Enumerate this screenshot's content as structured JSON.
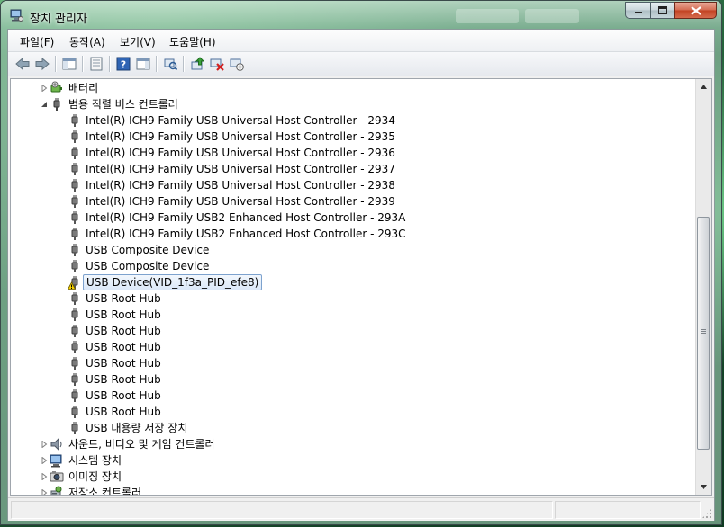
{
  "window": {
    "title": "장치 관리자"
  },
  "menubar": {
    "items": [
      "파일(F)",
      "동작(A)",
      "보기(V)",
      "도움말(H)"
    ]
  },
  "tree": {
    "rows": [
      {
        "label": "배터리",
        "level": 1,
        "expander": "collapsed",
        "icon": "battery-icon"
      },
      {
        "label": "범용 직렬 버스 컨트롤러",
        "level": 1,
        "expander": "expanded",
        "icon": "usb-controller-icon"
      },
      {
        "label": "Intel(R) ICH9 Family USB Universal Host Controller - 2934",
        "level": 2,
        "icon": "usb-plug-icon"
      },
      {
        "label": "Intel(R) ICH9 Family USB Universal Host Controller - 2935",
        "level": 2,
        "icon": "usb-plug-icon"
      },
      {
        "label": "Intel(R) ICH9 Family USB Universal Host Controller - 2936",
        "level": 2,
        "icon": "usb-plug-icon"
      },
      {
        "label": "Intel(R) ICH9 Family USB Universal Host Controller - 2937",
        "level": 2,
        "icon": "usb-plug-icon"
      },
      {
        "label": "Intel(R) ICH9 Family USB Universal Host Controller - 2938",
        "level": 2,
        "icon": "usb-plug-icon"
      },
      {
        "label": "Intel(R) ICH9 Family USB Universal Host Controller - 2939",
        "level": 2,
        "icon": "usb-plug-icon"
      },
      {
        "label": "Intel(R) ICH9 Family USB2 Enhanced Host Controller - 293A",
        "level": 2,
        "icon": "usb-plug-icon"
      },
      {
        "label": "Intel(R) ICH9 Family USB2 Enhanced Host Controller - 293C",
        "level": 2,
        "icon": "usb-plug-icon"
      },
      {
        "label": "USB Composite Device",
        "level": 2,
        "icon": "usb-plug-icon"
      },
      {
        "label": "USB Composite Device",
        "level": 2,
        "icon": "usb-plug-icon"
      },
      {
        "label": "USB Device(VID_1f3a_PID_efe8)",
        "level": 2,
        "icon": "usb-warning-icon",
        "selected": true
      },
      {
        "label": "USB Root Hub",
        "level": 2,
        "icon": "usb-plug-icon"
      },
      {
        "label": "USB Root Hub",
        "level": 2,
        "icon": "usb-plug-icon"
      },
      {
        "label": "USB Root Hub",
        "level": 2,
        "icon": "usb-plug-icon"
      },
      {
        "label": "USB Root Hub",
        "level": 2,
        "icon": "usb-plug-icon"
      },
      {
        "label": "USB Root Hub",
        "level": 2,
        "icon": "usb-plug-icon"
      },
      {
        "label": "USB Root Hub",
        "level": 2,
        "icon": "usb-plug-icon"
      },
      {
        "label": "USB Root Hub",
        "level": 2,
        "icon": "usb-plug-icon"
      },
      {
        "label": "USB Root Hub",
        "level": 2,
        "icon": "usb-plug-icon"
      },
      {
        "label": "USB 대용량 저장 장치",
        "level": 2,
        "icon": "usb-plug-icon"
      },
      {
        "label": "사운드, 비디오 및 게임 컨트롤러",
        "level": 1,
        "expander": "collapsed",
        "icon": "speaker-icon"
      },
      {
        "label": "시스템 장치",
        "level": 1,
        "expander": "collapsed",
        "icon": "system-device-icon"
      },
      {
        "label": "이미징 장치",
        "level": 1,
        "expander": "collapsed",
        "icon": "imaging-device-icon"
      },
      {
        "label": "저장소 컨트롤러",
        "level": 1,
        "expander": "collapsed",
        "icon": "storage-controller-icon"
      }
    ]
  },
  "colors": {
    "selection_border": "#7da2ce",
    "selection_fill": "#dbe8f8",
    "close_button": "#c24323"
  }
}
